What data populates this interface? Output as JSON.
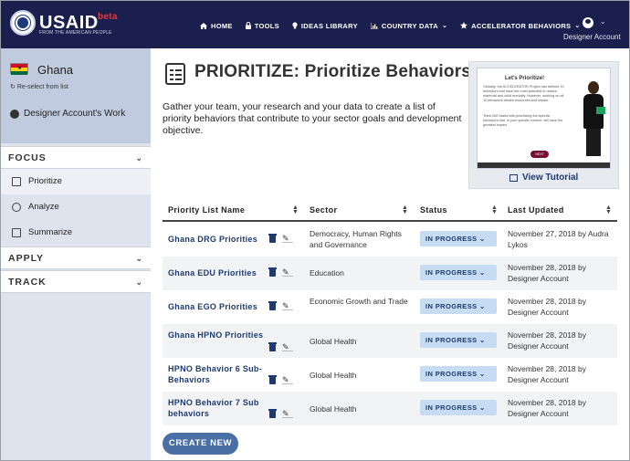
{
  "header": {
    "brand": "USAID",
    "brand_sub": "FROM THE AMERICAN PEOPLE",
    "beta": "beta",
    "nav": [
      {
        "label": "HOME",
        "icon": "home-icon"
      },
      {
        "label": "TOOLS",
        "icon": "lock-icon"
      },
      {
        "label": "IDEAS LIBRARY",
        "icon": "lightbulb-icon"
      },
      {
        "label": "COUNTRY DATA",
        "icon": "bar-chart-icon"
      },
      {
        "label": "ACCELERATOR BEHAVIORS",
        "icon": "star-icon"
      }
    ],
    "account_label": "Designer Account"
  },
  "sidebar": {
    "country": "Ghana",
    "reselect": "Re-select from list",
    "work_title": "Designer Account's Work",
    "sections": [
      {
        "label": "FOCUS"
      },
      {
        "label": "APPLY"
      },
      {
        "label": "TRACK"
      }
    ],
    "focus_items": [
      {
        "label": "Prioritize"
      },
      {
        "label": "Analyze"
      },
      {
        "label": "Summarize"
      }
    ]
  },
  "main": {
    "title": "PRIORITIZE: Prioritize Behaviors",
    "intro": "Gather your team, your research and your data to create a list of priority behaviors that contribute to your sector goals and development objective.",
    "tutorial": {
      "video_heading": "Let's Prioritize!",
      "video_text_1": "Globally, the ACCELERATOR Project has defined 10 behaviors that have the most potential to reduce maternal and child mortality. However, working on all 10 behaviors dilutes resources and impact.",
      "video_text_2": "Think BIG starts with prioritizing the specific behaviors that, in your specific context, will have the greatest impact.",
      "next_label": "NEXT",
      "link": "View Tutorial"
    },
    "table": {
      "columns": [
        "Priority List Name",
        "Sector",
        "Status",
        "Last Updated"
      ],
      "rows": [
        {
          "name": "Ghana DRG Priorities",
          "sector": "Democracy, Human Rights and Governance",
          "status": "IN PROGRESS",
          "updated": "November 27, 2018 by Audra Lykos"
        },
        {
          "name": "Ghana EDU Priorities",
          "sector": "Education",
          "status": "IN PROGRESS",
          "updated": "November 28, 2018 by Designer Account"
        },
        {
          "name": "Ghana EGO Priorities",
          "sector": "Economic Growth and Trade",
          "status": "IN PROGRESS",
          "updated": "November 28, 2018 by Designer Account"
        },
        {
          "name": "Ghana HPNO Priorities",
          "sector": "Global Health",
          "status": "IN PROGRESS",
          "updated": "November 28, 2018 by Designer Account"
        },
        {
          "name": "HPNO Behavior 6 Sub-Behaviors",
          "sector": "Global Health",
          "status": "IN PROGRESS",
          "updated": "November 28, 2018 by Designer Account"
        },
        {
          "name": "HPNO Behavior 7 Sub behaviors",
          "sector": "Global Health",
          "status": "IN PROGRESS",
          "updated": "November 28, 2018 by Designer Account"
        }
      ]
    },
    "create_label": "CREATE NEW"
  },
  "colors": {
    "header_bg": "#1b1f4e",
    "link": "#1d3a72",
    "status_bg": "#c6dcf2",
    "create_bg": "#4a6fa5",
    "beta": "#e03a3e"
  }
}
